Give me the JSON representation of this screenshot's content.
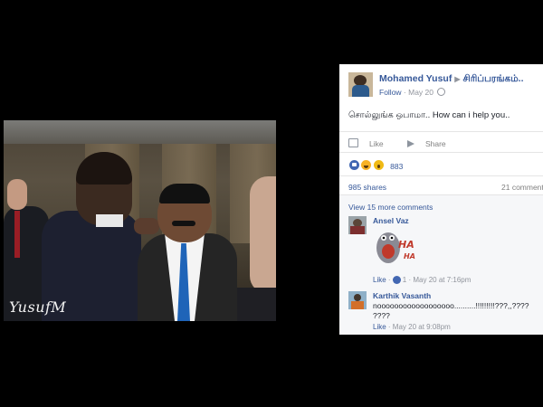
{
  "photo": {
    "watermark": "YusufM"
  },
  "post": {
    "author": "Mohamed Yusuf",
    "page": "சிரிப்பரங்கம்..",
    "follow_label": "Follow",
    "date": "May 20",
    "text": "சொல்லுங்க ஒபாமா.. How can i help you..",
    "actions": {
      "like": "Like",
      "share": "Share"
    },
    "reactions": {
      "count": "883",
      "types": [
        "like-icon",
        "haha-icon",
        "wow-icon"
      ]
    },
    "shares": "985 shares",
    "comments_count": "21 comment",
    "view_more": "View 15 more comments"
  },
  "comments": [
    {
      "author": "Ansel Vaz",
      "sticker_text": "HA HA",
      "meta_like": "Like",
      "meta_likes": "1",
      "meta_time": "May 20 at 7:16pm"
    },
    {
      "author": "Karthik Vasanth",
      "text_line1": "noooooooooooooooooo..........!!!!!!!!!???,,????",
      "text_line2": "????",
      "meta_like": "Like",
      "meta_time": "May 20 at 9:08pm"
    }
  ],
  "colors": {
    "link": "#365899",
    "muted": "#90949c",
    "background": "#000000"
  }
}
